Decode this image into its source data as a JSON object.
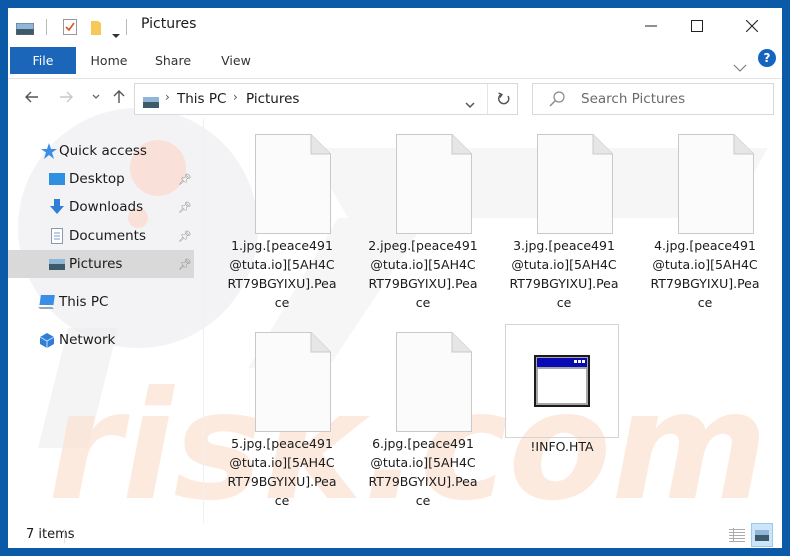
{
  "window": {
    "title": "Pictures",
    "controls": {
      "minimize": "minimize",
      "maximize": "maximize",
      "close": "close"
    }
  },
  "ribbon": {
    "tabs": [
      {
        "label": "File",
        "active": true
      },
      {
        "label": "Home"
      },
      {
        "label": "Share"
      },
      {
        "label": "View"
      }
    ],
    "help_label": "?"
  },
  "navigation": {
    "breadcrumb": [
      "This PC",
      "Pictures"
    ],
    "search_placeholder": "Search Pictures"
  },
  "sidebar": {
    "quick_access_label": "Quick access",
    "pinned": [
      {
        "label": "Desktop",
        "icon": "desktop-icon",
        "pinned": true
      },
      {
        "label": "Downloads",
        "icon": "downloads-icon",
        "pinned": true
      },
      {
        "label": "Documents",
        "icon": "documents-icon",
        "pinned": true
      },
      {
        "label": "Pictures",
        "icon": "pictures-icon",
        "pinned": true,
        "selected": true
      }
    ],
    "this_pc_label": "This PC",
    "network_label": "Network"
  },
  "files": [
    {
      "name": "1.jpg.[peace491@tuta.io][5AH4CRT79BGYIXU].Peace",
      "lines": [
        "1.jpg.[peace491",
        "@tuta.io][5AH4C",
        "RT79BGYIXU].Pea",
        "ce"
      ],
      "icon": "blank-file-icon"
    },
    {
      "name": "2.jpeg.[peace491@tuta.io][5AH4CRT79BGYIXU].Peace",
      "lines": [
        "2.jpeg.[peace491",
        "@tuta.io][5AH4C",
        "RT79BGYIXU].Pea",
        "ce"
      ],
      "icon": "blank-file-icon"
    },
    {
      "name": "3.jpg.[peace491@tuta.io][5AH4CRT79BGYIXU].Peace",
      "lines": [
        "3.jpg.[peace491",
        "@tuta.io][5AH4C",
        "RT79BGYIXU].Pea",
        "ce"
      ],
      "icon": "blank-file-icon"
    },
    {
      "name": "4.jpg.[peace491@tuta.io][5AH4CRT79BGYIXU].Peace",
      "lines": [
        "4.jpg.[peace491",
        "@tuta.io][5AH4C",
        "RT79BGYIXU].Pea",
        "ce"
      ],
      "icon": "blank-file-icon"
    },
    {
      "name": "5.jpg.[peace491@tuta.io][5AH4CRT79BGYIXU].Peace",
      "lines": [
        "5.jpg.[peace491",
        "@tuta.io][5AH4C",
        "RT79BGYIXU].Pea",
        "ce"
      ],
      "icon": "blank-file-icon"
    },
    {
      "name": "6.jpg.[peace491@tuta.io][5AH4CRT79BGYIXU].Peace",
      "lines": [
        "6.jpg.[peace491",
        "@tuta.io][5AH4C",
        "RT79BGYIXU].Pea",
        "ce"
      ],
      "icon": "blank-file-icon"
    },
    {
      "name": "!INFO.HTA",
      "lines": [
        "!INFO.HTA"
      ],
      "icon": "hta-application-icon"
    }
  ],
  "status": {
    "item_count": "7 items"
  },
  "watermark": {
    "text": "risk.com"
  },
  "colors": {
    "frame": "#0a5aa8",
    "file_tab": "#1b66b9",
    "selected_nav": "#d9d9d9",
    "help_icon": "#1565c0"
  }
}
